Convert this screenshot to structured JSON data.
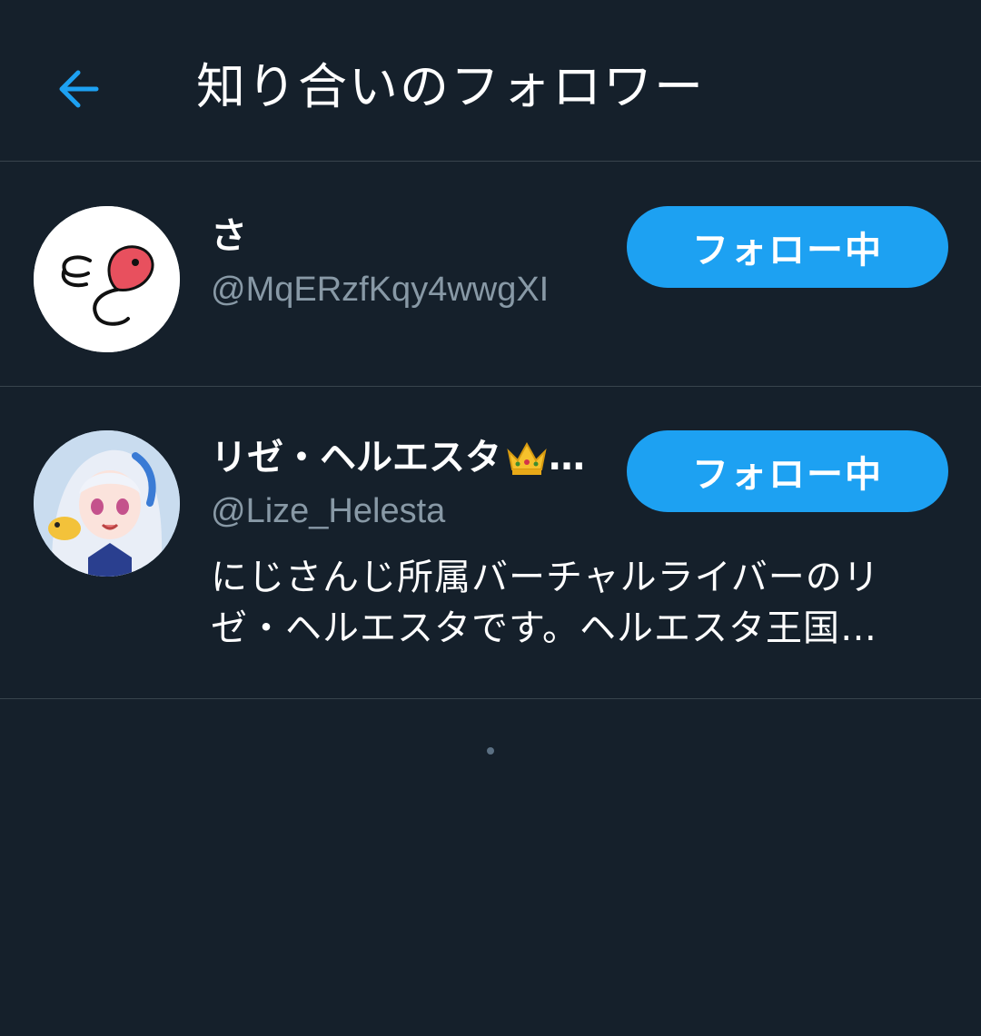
{
  "header": {
    "back_icon": "arrow-left-icon",
    "title": "知り合いのフォロワー"
  },
  "users": [
    {
      "display_name": "さ",
      "handle": "@MqERzfKqy4wwgXI",
      "follow_label": "フォロー中",
      "avatar": "abstract-pink-blob-avatar"
    },
    {
      "display_name": "リゼ・ヘルエスタ",
      "name_emoji": "crown-emoji",
      "name_truncation": "…",
      "handle": "@Lize_Helesta",
      "bio_line_1": "にじさんじ所属バーチャルライバーのリ",
      "bio_line_2": "ゼ・ヘルエスタです。ヘルエスタ王国…",
      "follow_label": "フォロー中",
      "avatar": "anime-girl-avatar"
    }
  ],
  "colors": {
    "background": "#15202b",
    "divider": "#38444d",
    "accent": "#1da1f2",
    "secondary_text": "#8899a6"
  }
}
